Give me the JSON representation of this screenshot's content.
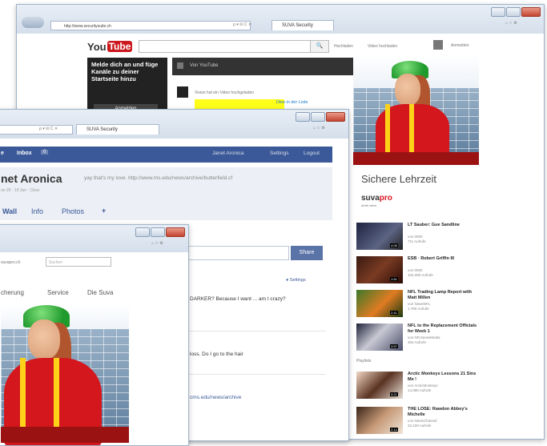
{
  "back_window": {
    "address": "http://www.securitysuite.ch",
    "addr_controls": "ρ ▾ ☒ C ✕",
    "tab_label": "SUVA Security",
    "youtube": {
      "logo_you": "You",
      "logo_tube": "Tube",
      "search_icon": "🔍",
      "links": [
        "Hochladen",
        "Video hochladen"
      ],
      "signin": "Anmelden",
      "promo_text": "Melde dich an und füge Kanäle zu deiner Startseite hinzu",
      "promo_button": "Anmelden",
      "feed_header": "Von YouTube",
      "feed_item_meta": "Vision hat ein Video hochgeladen",
      "feed_link": "Dies in der Liste",
      "ad_caption": "Sichere Lehrzeit",
      "ad_brand_a": "suva",
      "ad_brand_b": "pro",
      "ad_brand_tagline": "Arbeit sicher",
      "sidebar_videos": [
        {
          "title": "LT Sauber: Gue Sandline",
          "sub": "von 0000",
          "meta": "711 Aufrufe",
          "dur": "4:08"
        },
        {
          "title": "ESB · Robert Griffin III",
          "sub": "von 0000",
          "meta": "103.280 Aufrufe",
          "dur": "1:51"
        },
        {
          "title": "NFL Trading Lamp Report with Matt Millen",
          "sub": "von NewsNFL",
          "meta": "1.780 Aufrufe",
          "dur": "2:41"
        },
        {
          "title": "NFL to the Replacement Officials for Week 1",
          "sub": "von NFLNewsMedia",
          "meta": "304 Aufrufe",
          "dur": "3:57"
        }
      ],
      "playlist_label": "Playlists",
      "playlist_videos": [
        {
          "title": "Arctic Monkeys Lessons 21 Sins Me !",
          "sub": "von ArcticMonkeys",
          "meta": "14.080 Aufrufe",
          "dur": "3:21"
        },
        {
          "title": "THE LOSE: Rawdon Abbey's Michelle",
          "sub": "von NewsChannel",
          "meta": "32.100 Aufrufe",
          "dur": "2:14"
        }
      ]
    }
  },
  "middle_window": {
    "addr_controls": "ρ ▾ ☒ C ✕",
    "tab_label": "SUVA Security",
    "facebook": {
      "nav_left": "e",
      "nav_inbox": "Inbox",
      "nav_inbox_count": "0",
      "nav_right": [
        "Janet Aronica",
        "Settings",
        "Logout"
      ],
      "profile_name": "net Aronica",
      "profile_status": "yay that's my love. http://www.ms.edu/news/archive/butterfield.cf",
      "profile_sub": "on 20 · 10 Jan · Clear",
      "tabs": [
        "Wall",
        "Info",
        "Photos",
        "+"
      ],
      "share_button": "Share",
      "settings_link": "Settings",
      "post1": "DARKER? Because I want ... am I crazy?",
      "post2": "loss. Do I go to the hair",
      "post3": "cms.edu/news/archive"
    }
  },
  "front_window": {
    "address_text": "suvapro.ch",
    "search_placeholder": "Suchen",
    "nav": [
      "cherung",
      "Service",
      "Die Suva"
    ]
  },
  "colors": {
    "facebook_blue": "#3b5998",
    "youtube_red": "#cc181e",
    "suva_red": "#d4161d",
    "suva_yellow": "#ffd21a"
  }
}
